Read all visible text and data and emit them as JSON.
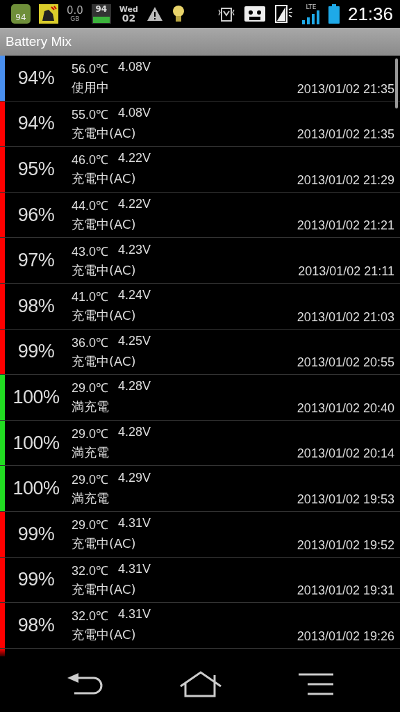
{
  "status_bar": {
    "android_badge": "94",
    "storage_value": "0.0",
    "storage_unit": "GB",
    "battery_widget": "94",
    "weekday": "Wed",
    "day": "02",
    "network": "LTE",
    "time": "21:36"
  },
  "title_bar": {
    "title": "Battery Mix"
  },
  "entries": [
    {
      "percent": "94%",
      "temperature": "56.0℃",
      "voltage": "4.08V",
      "status": "使用中",
      "datetime": "2013/01/02 21:35",
      "color": "#4a90f0"
    },
    {
      "percent": "94%",
      "temperature": "55.0℃",
      "voltage": "4.08V",
      "status": "充電中(AC)",
      "datetime": "2013/01/02 21:35",
      "color": "#ff0000"
    },
    {
      "percent": "95%",
      "temperature": "46.0℃",
      "voltage": "4.22V",
      "status": "充電中(AC)",
      "datetime": "2013/01/02 21:29",
      "color": "#ff0000"
    },
    {
      "percent": "96%",
      "temperature": "44.0℃",
      "voltage": "4.22V",
      "status": "充電中(AC)",
      "datetime": "2013/01/02 21:21",
      "color": "#ff0000"
    },
    {
      "percent": "97%",
      "temperature": "43.0℃",
      "voltage": "4.23V",
      "status": "充電中(AC)",
      "datetime": "2013/01/02 21:11",
      "color": "#ff0000"
    },
    {
      "percent": "98%",
      "temperature": "41.0℃",
      "voltage": "4.24V",
      "status": "充電中(AC)",
      "datetime": "2013/01/02 21:03",
      "color": "#ff0000"
    },
    {
      "percent": "99%",
      "temperature": "36.0℃",
      "voltage": "4.25V",
      "status": "充電中(AC)",
      "datetime": "2013/01/02 20:55",
      "color": "#ff0000"
    },
    {
      "percent": "100%",
      "temperature": "29.0℃",
      "voltage": "4.28V",
      "status": "満充電",
      "datetime": "2013/01/02 20:40",
      "color": "#22dd22"
    },
    {
      "percent": "100%",
      "temperature": "29.0℃",
      "voltage": "4.28V",
      "status": "満充電",
      "datetime": "2013/01/02 20:14",
      "color": "#22dd22"
    },
    {
      "percent": "100%",
      "temperature": "29.0℃",
      "voltage": "4.29V",
      "status": "満充電",
      "datetime": "2013/01/02 19:53",
      "color": "#22dd22"
    },
    {
      "percent": "99%",
      "temperature": "29.0℃",
      "voltage": "4.31V",
      "status": "充電中(AC)",
      "datetime": "2013/01/02 19:52",
      "color": "#ff0000"
    },
    {
      "percent": "99%",
      "temperature": "32.0℃",
      "voltage": "4.31V",
      "status": "充電中(AC)",
      "datetime": "2013/01/02 19:31",
      "color": "#ff0000"
    },
    {
      "percent": "98%",
      "temperature": "32.0℃",
      "voltage": "4.31V",
      "status": "充電中(AC)",
      "datetime": "2013/01/02 19:26",
      "color": "#ff0000"
    }
  ]
}
